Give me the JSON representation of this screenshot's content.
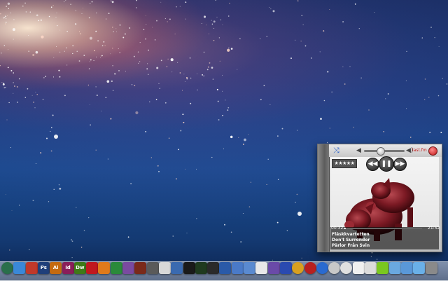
{
  "player": {
    "shuffle_icon": "shuffle-icon",
    "rating": "★★★★★",
    "lastfm_label": "last.fm",
    "time_elapsed": "00:32",
    "time_total": "21:52",
    "progress": 0.025,
    "volume": 0.4,
    "artist": "Fläskkvartetten",
    "title": "Don't Surrender",
    "album": "Pärlor Från Svin",
    "controls": {
      "prev": "◀◀",
      "play": "❚❚",
      "next": "▶▶"
    }
  },
  "dock": {
    "icons": [
      {
        "name": "time-machine-icon",
        "label": "",
        "color": "#2a6f4b"
      },
      {
        "name": "finder-icon",
        "label": "",
        "color": "#3a88d8"
      },
      {
        "name": "script-editor-icon",
        "label": "",
        "color": "#c0392b"
      },
      {
        "name": "photoshop-icon",
        "label": "Ps",
        "color": "#1f3f7a"
      },
      {
        "name": "illustrator-icon",
        "label": "Ai",
        "color": "#c46a10"
      },
      {
        "name": "indesign-icon",
        "label": "Id",
        "color": "#8a1e5a"
      },
      {
        "name": "dreamweaver-icon",
        "label": "Dw",
        "color": "#3f7a18"
      },
      {
        "name": "acrobat-icon",
        "label": "",
        "color": "#c0181f"
      },
      {
        "name": "app-orange-icon",
        "label": "",
        "color": "#e07a1a"
      },
      {
        "name": "chart-icon",
        "label": "",
        "color": "#2a8a3a"
      },
      {
        "name": "pencil-icon",
        "label": "",
        "color": "#7a4aa0"
      },
      {
        "name": "pig-icon",
        "label": "",
        "color": "#7a2a1a"
      },
      {
        "name": "tools-icon",
        "label": "",
        "color": "#5a5a5a"
      },
      {
        "name": "document-icon",
        "label": "",
        "color": "#d8d8d8"
      },
      {
        "name": "plane-icon",
        "label": "",
        "color": "#3a6ab0"
      },
      {
        "name": "terminal-icon",
        "label": "",
        "color": "#1a1a1a"
      },
      {
        "name": "activity-monitor-icon",
        "label": "",
        "color": "#1f3a1f"
      },
      {
        "name": "console-icon",
        "label": "",
        "color": "#2a2a2a"
      },
      {
        "name": "app-blue-icon",
        "label": "",
        "color": "#2a5aa8"
      },
      {
        "name": "network-icon",
        "label": "",
        "color": "#4a7ac8"
      },
      {
        "name": "preview-icon",
        "label": "",
        "color": "#5a8ad0"
      },
      {
        "name": "textedit-icon",
        "label": "",
        "color": "#e8e8e8"
      },
      {
        "name": "app-purple-icon",
        "label": "",
        "color": "#6a4aa8"
      },
      {
        "name": "app-flag-icon",
        "label": "",
        "color": "#2a4ab0"
      },
      {
        "name": "chrome-icon",
        "label": "",
        "color": "#d8a020"
      },
      {
        "name": "target-icon",
        "label": "",
        "color": "#b82020"
      },
      {
        "name": "globe-icon",
        "label": "",
        "color": "#2a6ad0"
      },
      {
        "name": "cd-icon",
        "label": "",
        "color": "#c8c8c8"
      },
      {
        "name": "ball-icon",
        "label": "",
        "color": "#e0e0e0"
      },
      {
        "name": "file-icon",
        "label": "",
        "color": "#f0f0f0"
      },
      {
        "name": "text-file-icon",
        "label": "",
        "color": "#dcdcdc"
      },
      {
        "name": "battery-icon",
        "label": "",
        "color": "#7ac820"
      },
      {
        "name": "folder-icon",
        "label": "",
        "color": "#6aa8e0"
      },
      {
        "name": "applications-folder-icon",
        "label": "",
        "color": "#5a98d8"
      },
      {
        "name": "downloads-folder-icon",
        "label": "",
        "color": "#6ab0e8"
      },
      {
        "name": "trash-icon",
        "label": "",
        "color": "#8a8a8a"
      }
    ]
  }
}
